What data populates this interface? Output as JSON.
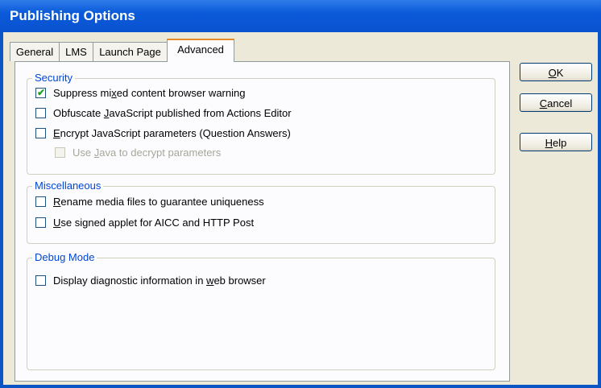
{
  "window": {
    "title": "Publishing Options"
  },
  "tabs": [
    {
      "label": "General"
    },
    {
      "label": "LMS"
    },
    {
      "label": "Launch Page"
    },
    {
      "label": "Advanced",
      "selected": true
    }
  ],
  "security": {
    "legend": "Security",
    "options": [
      {
        "pre": "Suppress mi",
        "u": "x",
        "post": "ed content browser warning",
        "checked": true
      },
      {
        "pre": "Obfuscate ",
        "u": "J",
        "post": "avaScript published from Actions Editor",
        "checked": false
      },
      {
        "pre": "",
        "u": "E",
        "post": "ncrypt JavaScript parameters (Question Answers)",
        "checked": false
      },
      {
        "pre": "Use ",
        "u": "J",
        "post": "ava to decrypt parameters",
        "checked": false,
        "disabled": true
      }
    ]
  },
  "misc": {
    "legend": "Miscellaneous",
    "options": [
      {
        "pre": "",
        "u": "R",
        "post": "ename media files to guarantee uniqueness",
        "checked": false
      },
      {
        "pre": "",
        "u": "U",
        "post": "se signed applet for AICC and HTTP Post",
        "checked": false
      }
    ]
  },
  "debug": {
    "legend": "Debug Mode",
    "options": [
      {
        "pre": "Display diagnostic information in ",
        "u": "w",
        "post": "eb browser",
        "checked": false
      }
    ]
  },
  "buttons": {
    "ok": {
      "u": "O",
      "post": "K"
    },
    "cancel": {
      "u": "C",
      "post": "ancel"
    },
    "help": {
      "u": "H",
      "post": "elp"
    }
  },
  "colors": {
    "titlebar": "#0b5ad9",
    "group_legend": "#0046d5",
    "check_tick": "#21a121"
  }
}
